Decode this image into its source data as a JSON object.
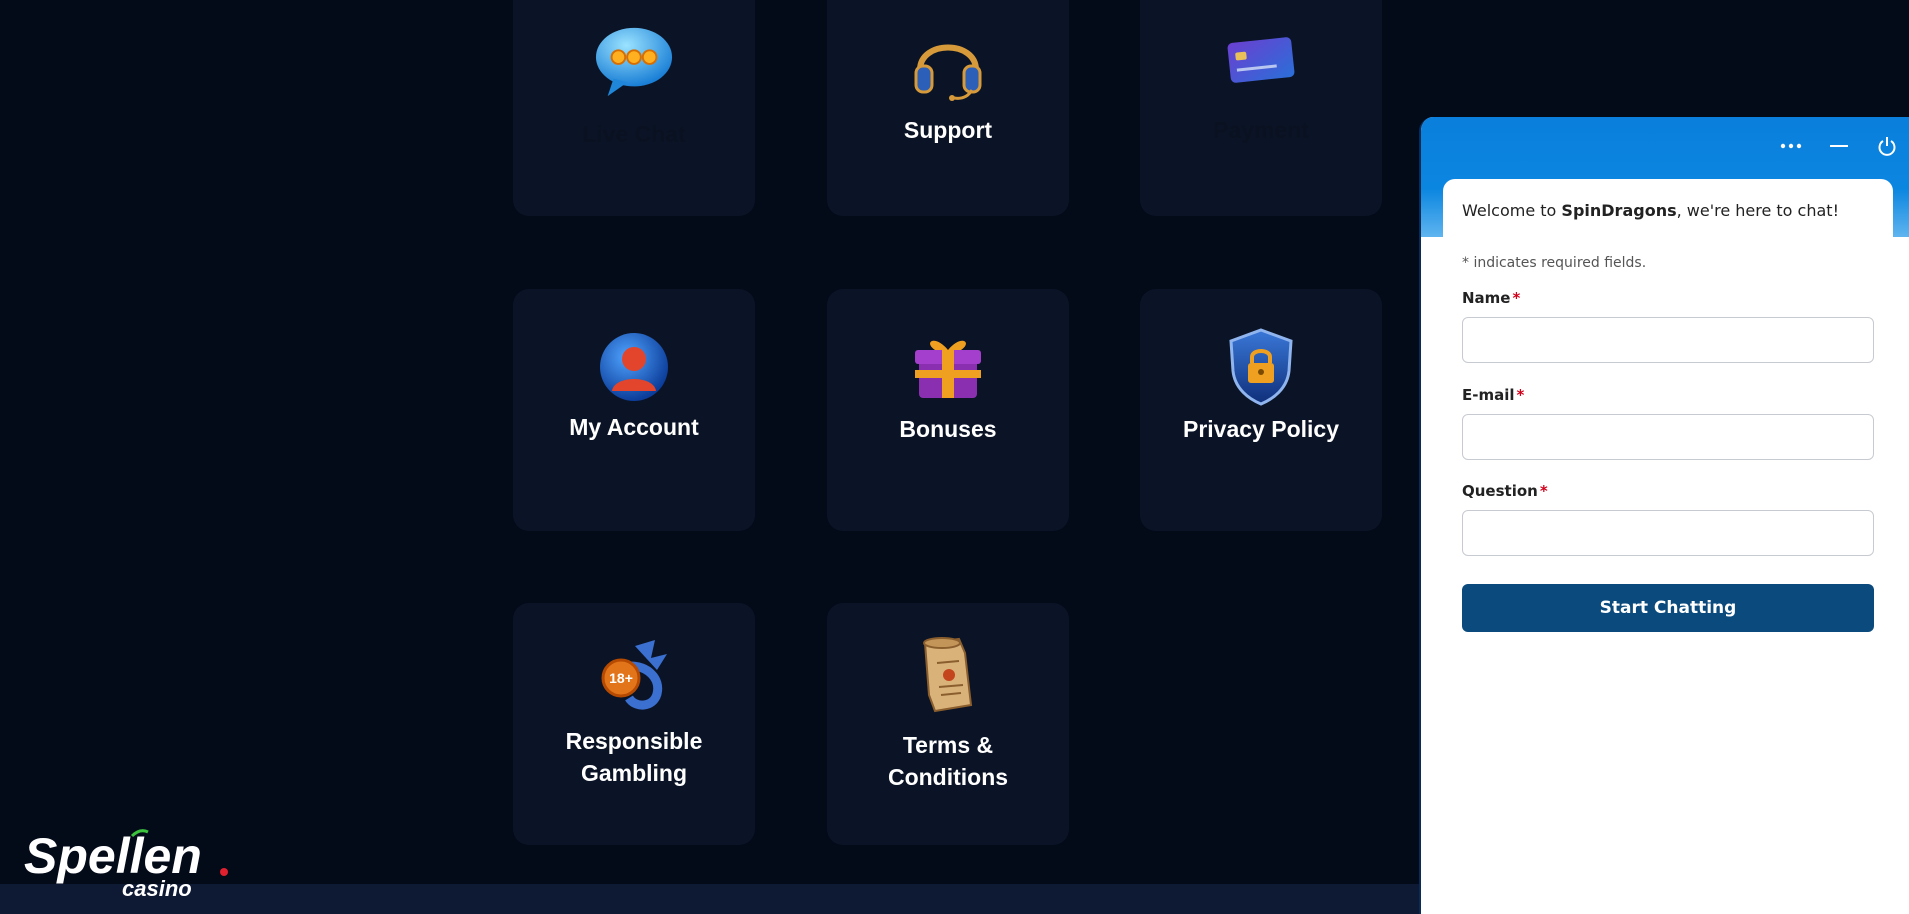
{
  "cards": [
    {
      "label": "Live Chat",
      "icon": "chat-bubble-icon"
    },
    {
      "label": "Support",
      "icon": "headset-icon"
    },
    {
      "label": "Payment",
      "icon": "credit-card-icon"
    },
    {
      "label": "My Account",
      "icon": "user-icon"
    },
    {
      "label": "Bonuses",
      "icon": "gift-icon"
    },
    {
      "label": "Privacy Policy",
      "icon": "shield-lock-icon"
    },
    {
      "label": "Responsible Gambling",
      "icon": "dragon-18-icon"
    },
    {
      "label": "Terms & Conditions",
      "icon": "scroll-icon"
    }
  ],
  "chat": {
    "welcome_prefix": "Welcome to ",
    "brand": "SpinDragons",
    "welcome_suffix": ", we're here to chat!",
    "required_note": "* indicates required fields.",
    "fields": [
      {
        "label": "Name",
        "value": ""
      },
      {
        "label": "E-mail",
        "value": ""
      },
      {
        "label": "Question",
        "value": ""
      }
    ],
    "required_mark": "*",
    "start_button": "Start Chatting",
    "header_icons": [
      "more-icon",
      "minimize-icon",
      "power-icon"
    ]
  },
  "logo": {
    "text": "Spellen",
    "subtext": "casino"
  },
  "colors": {
    "page_bg": "#030a18",
    "card_bg": "#0b1426",
    "chat_header": "#0a7fdc",
    "button": "#0b4a7d",
    "required": "#d0021b"
  }
}
